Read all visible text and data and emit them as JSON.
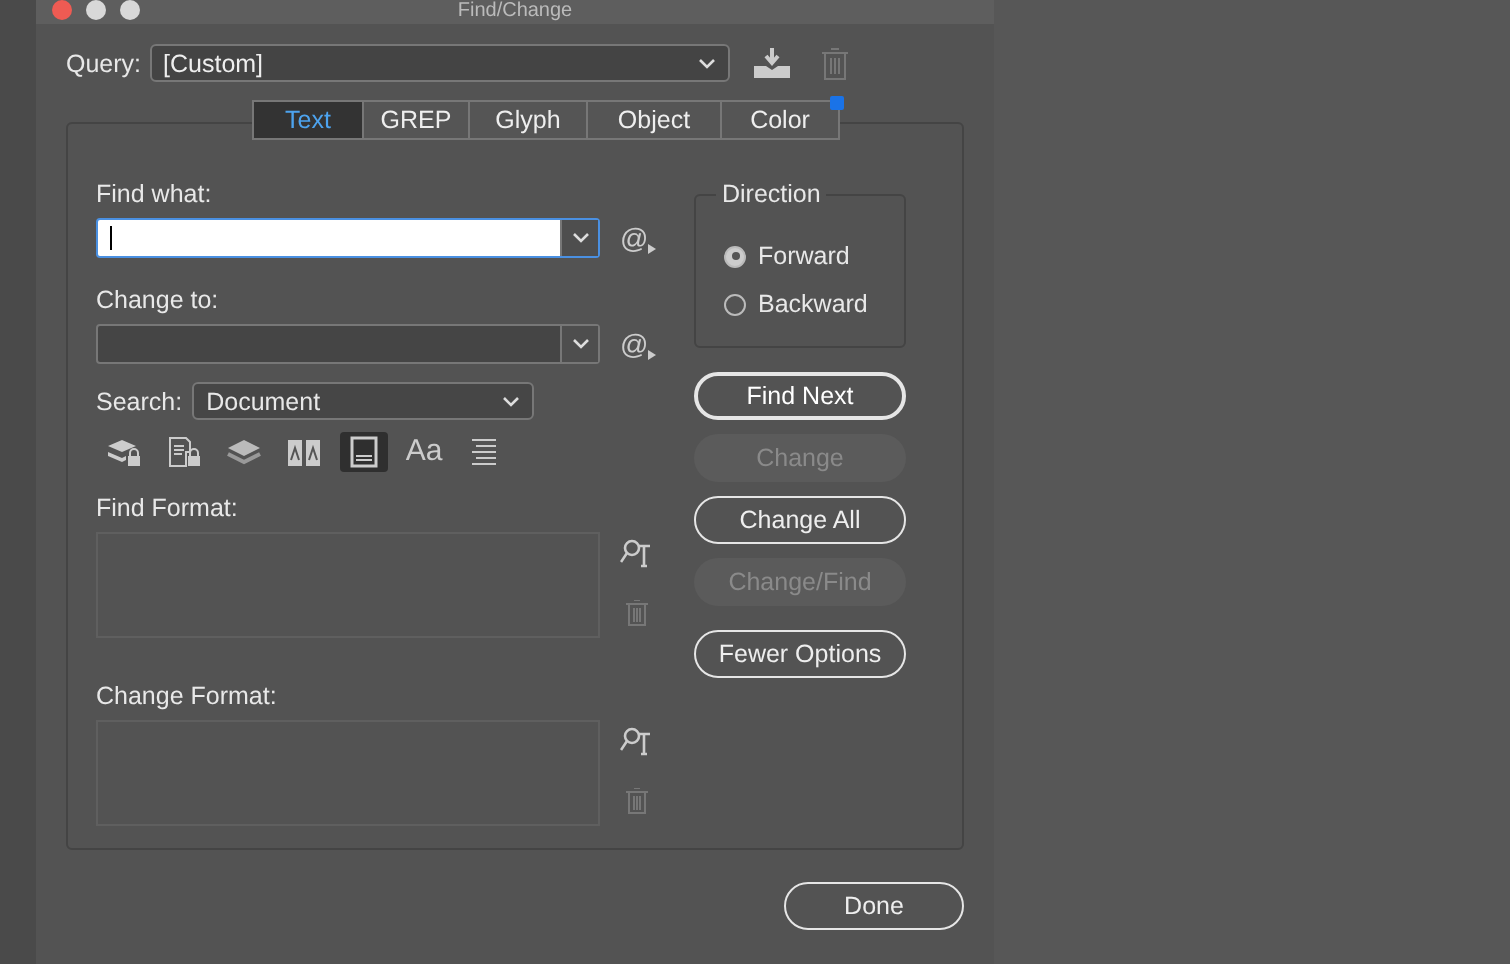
{
  "window": {
    "title": "Find/Change"
  },
  "query": {
    "label": "Query:",
    "value": "[Custom]"
  },
  "tabs": [
    {
      "label": "Text",
      "selected": true,
      "modified": false
    },
    {
      "label": "GREP",
      "selected": false,
      "modified": false
    },
    {
      "label": "Glyph",
      "selected": false,
      "modified": false
    },
    {
      "label": "Object",
      "selected": false,
      "modified": false
    },
    {
      "label": "Color",
      "selected": false,
      "modified": true
    }
  ],
  "find_what": {
    "label": "Find what:",
    "focused": true,
    "special_menu": "@"
  },
  "change_to": {
    "label": "Change to:",
    "focused": false,
    "special_menu": "@"
  },
  "search": {
    "label": "Search:",
    "value": "Document"
  },
  "search_options": [
    {
      "on": false
    },
    {
      "on": false
    },
    {
      "on": false
    },
    {
      "on": false
    },
    {
      "on": true
    },
    {
      "on": false,
      "glyph": "Aa"
    },
    {
      "on": false
    }
  ],
  "find_format": {
    "label": "Find Format:"
  },
  "change_format": {
    "label": "Change Format:"
  },
  "direction": {
    "label": "Direction",
    "options": [
      {
        "label": "Forward",
        "selected": true
      },
      {
        "label": "Backward",
        "selected": false
      }
    ]
  },
  "buttons": [
    {
      "label": "Find Next",
      "disabled": false,
      "default": true
    },
    {
      "label": "Change",
      "disabled": true,
      "default": false
    },
    {
      "label": "Change All",
      "disabled": false,
      "default": false
    },
    {
      "label": "Change/Find",
      "disabled": true,
      "default": false
    },
    {
      "label": "Fewer Options",
      "disabled": false,
      "default": false
    }
  ],
  "done": {
    "label": "Done"
  }
}
